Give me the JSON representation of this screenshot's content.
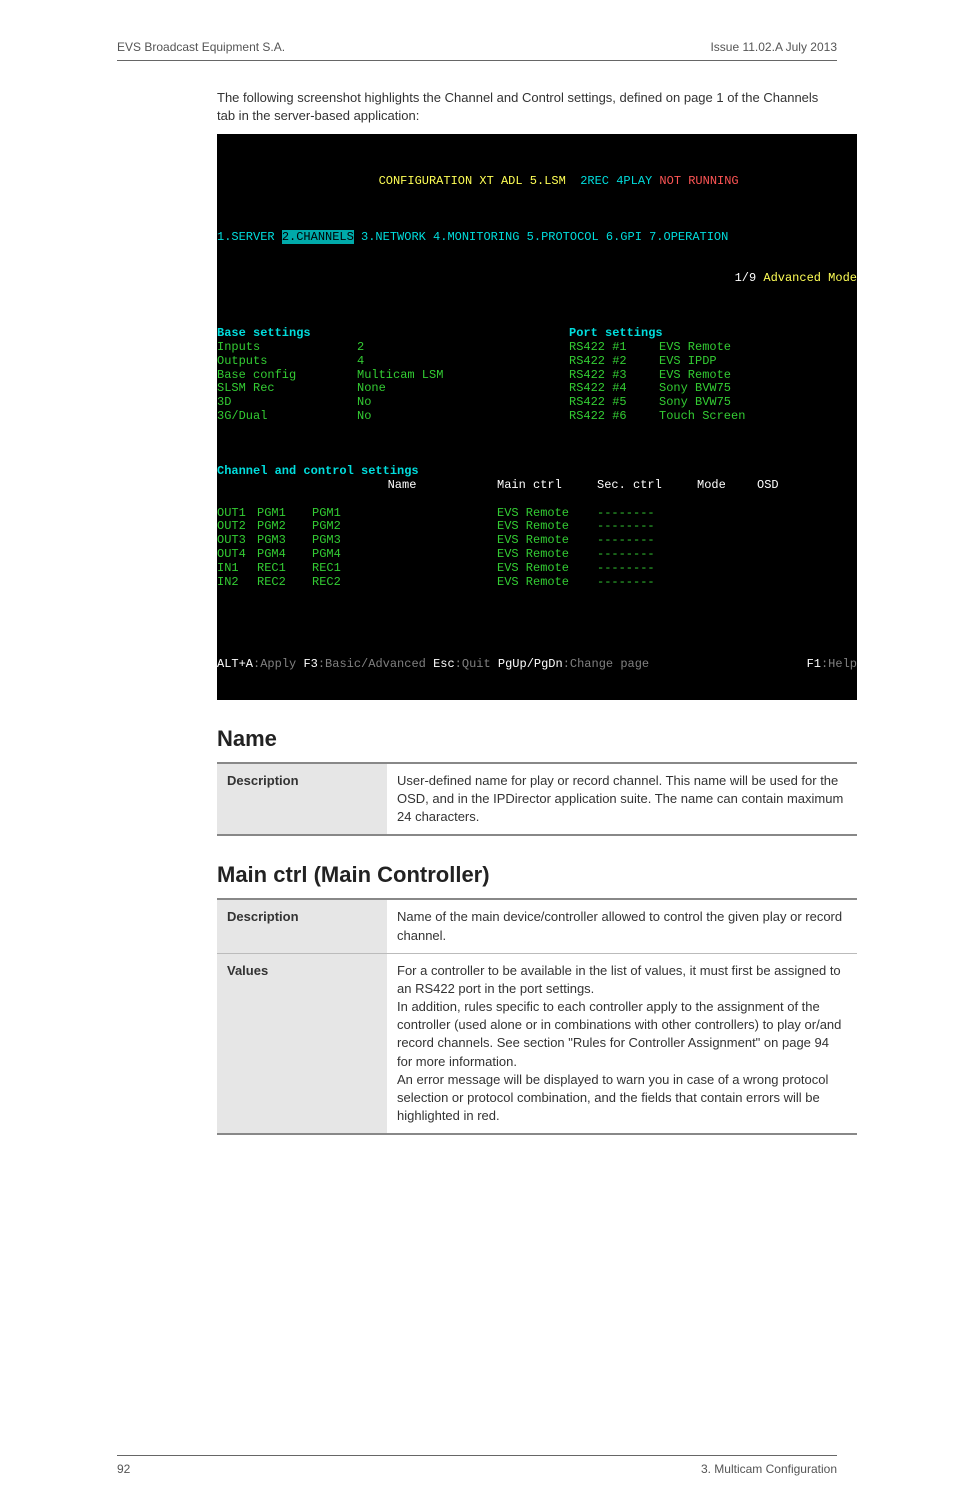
{
  "header": {
    "left": "EVS Broadcast Equipment S.A.",
    "right": "Issue 11.02.A  July 2013"
  },
  "intro": "The following screenshot highlights the Channel and Control settings, defined on page 1 of the Channels tab in the server-based application:",
  "terminal": {
    "title_left": "CONFIGURATION XT ADL 5.LSM",
    "title_mid": "2REC 4PLAY",
    "title_right": "NOT RUNNING",
    "tabs": [
      "1.SERVER",
      "2.CHANNELS",
      "3.NETWORK",
      "4.MONITORING",
      "5.PROTOCOL",
      "6.GPI",
      "7.OPERATION"
    ],
    "page_ind": "1/9",
    "mode": "Advanced Mode",
    "base_heading": "Base settings",
    "base": [
      {
        "label": "Inputs",
        "value": "2"
      },
      {
        "label": "Outputs",
        "value": "4"
      },
      {
        "label": "Base config",
        "value": "Multicam LSM"
      },
      {
        "label": "SLSM Rec",
        "value": "None"
      },
      {
        "label": "3D",
        "value": "No"
      },
      {
        "label": "3G/Dual",
        "value": "No"
      }
    ],
    "port_heading": "Port settings",
    "ports": [
      {
        "label": "RS422 #1",
        "value": "EVS Remote"
      },
      {
        "label": "RS422 #2",
        "value": "EVS IPDP"
      },
      {
        "label": "RS422 #3",
        "value": "EVS Remote"
      },
      {
        "label": "RS422 #4",
        "value": "Sony BVW75"
      },
      {
        "label": "RS422 #5",
        "value": "Sony BVW75"
      },
      {
        "label": "RS422 #6",
        "value": "Touch Screen"
      }
    ],
    "chan_heading": "Channel and control settings",
    "cols": {
      "name": "Name",
      "main": "Main ctrl",
      "sec": "Sec. ctrl",
      "mode": "Mode",
      "osd": "OSD"
    },
    "chans": [
      {
        "ch": "OUT1",
        "pgm": "PGM1",
        "name": "PGM1",
        "main": "EVS Remote",
        "sec": "--------"
      },
      {
        "ch": "OUT2",
        "pgm": "PGM2",
        "name": "PGM2",
        "main": "EVS Remote",
        "sec": "--------"
      },
      {
        "ch": "OUT3",
        "pgm": "PGM3",
        "name": "PGM3",
        "main": "EVS Remote",
        "sec": "--------"
      },
      {
        "ch": "OUT4",
        "pgm": "PGM4",
        "name": "PGM4",
        "main": "EVS Remote",
        "sec": "--------"
      },
      {
        "ch": "IN1",
        "pgm": "REC1",
        "name": "REC1",
        "main": "EVS Remote",
        "sec": "--------"
      },
      {
        "ch": "IN2",
        "pgm": "REC2",
        "name": "REC2",
        "main": "EVS Remote",
        "sec": "--------"
      }
    ],
    "foot": {
      "k1": "ALT+A",
      "v1": ":Apply ",
      "k2": "F3",
      "v2": ":Basic/Advanced ",
      "k3": "Esc",
      "v3": ":Quit ",
      "k4": "PgUp/PgDn",
      "v4": ":Change page",
      "k5": "F1",
      "v5": ":Help"
    }
  },
  "sectionA": {
    "title": "Name",
    "descLabel": "Description",
    "desc": "User-defined name for play or record channel. This name will be used for the OSD, and in the IPDirector application suite. The name can contain maximum 24 characters."
  },
  "sectionB": {
    "title": "Main ctrl (Main Controller)",
    "descLabel": "Description",
    "desc": "Name of the main device/controller allowed to control the given play or record channel.",
    "valLabel": "Values",
    "valText": "For a controller to be available in the list of values, it must first be assigned to an RS422 port in the port settings.\nIn addition, rules specific to each controller apply to the assignment of the controller (used alone or in combinations with other controllers) to play or/and record channels. See section \"Rules for Controller Assignment\" on page 94 for more information.\nAn error message will be displayed to warn you in case of a wrong protocol selection or protocol combination, and the fields that contain errors will be highlighted in red."
  },
  "footer": {
    "left": "92",
    "right": "3. Multicam Configuration"
  }
}
